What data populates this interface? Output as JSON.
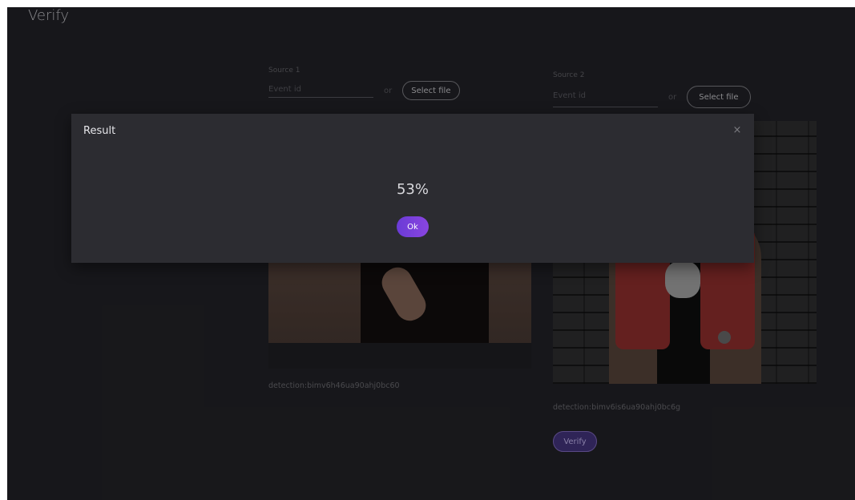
{
  "page": {
    "title": "Verify"
  },
  "sources": [
    {
      "label": "Source 1",
      "event_placeholder": "Event id",
      "or_text": "or",
      "select_file_label": "Select file",
      "detection": "detection:bimv6h46ua90ahj0bc60"
    },
    {
      "label": "Source 2",
      "event_placeholder": "Event id",
      "or_text": "or",
      "select_file_label": "Select file",
      "detection": "detection:bimv6is6ua90ahj0bc6g"
    }
  ],
  "actions": {
    "verify_label": "Verify"
  },
  "dialog": {
    "title": "Result",
    "close_icon": "×",
    "result_value": "53%",
    "ok_label": "Ok"
  },
  "colors": {
    "background": "#1d1d21",
    "dialog_bg": "#2c2c31",
    "accent": "#7a40dc",
    "verify_bg": "#3a2d6b"
  },
  "icons": {
    "close": "close-icon"
  }
}
